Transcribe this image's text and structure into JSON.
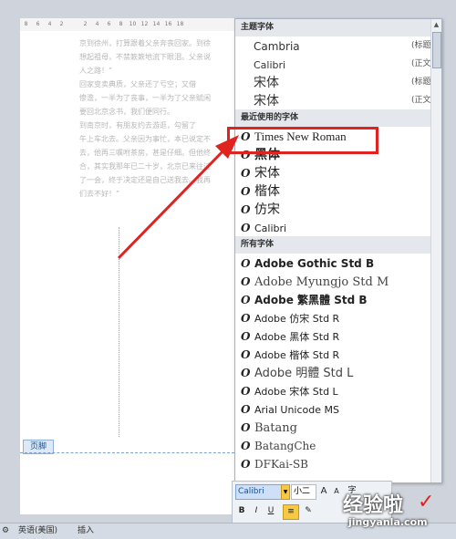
{
  "ruler": {
    "ticks": [
      "8",
      "6",
      "4",
      "2",
      "",
      "2",
      "4",
      "6",
      "8",
      "10",
      "12",
      "14",
      "16",
      "18"
    ]
  },
  "document": {
    "lines": [
      "京到徐州，打算跟着父亲奔丧回家。到徐",
      "想起祖母，不禁簌簌地流下眼泪。父亲说",
      "人之路！”",
      "",
      "回家变卖典质，父亲还了亏空；又借",
      "惨澹，一半为了丧事，一半为了父亲赋闲",
      "要回北京念书，我们便同行。",
      "",
      "到南京时，有朋友约去游逛，勾留了",
      "午上车北去。父亲因为事忙，本已说定不",
      "去，他再三嘱咐茶房，甚是仔细。但他终",
      "合，其实我那年已二十岁，北京已来往过",
      "了一会，终于决定还是自己送我去。我再",
      "们去不好！”"
    ],
    "footer_label": "页脚"
  },
  "font_menu": {
    "theme_header": "主题字体",
    "theme_fonts": [
      {
        "name": "Cambria",
        "tag": "(标题)"
      },
      {
        "name": "Calibri",
        "tag": "(正文)"
      },
      {
        "name": "宋体",
        "tag": "(标题)"
      },
      {
        "name": "宋体",
        "tag": "(正文)"
      }
    ],
    "recent_header": "最近使用的字体",
    "recent_fonts": [
      "Times New Roman",
      "黑体",
      "宋体",
      "楷体",
      "仿宋",
      "Calibri"
    ],
    "all_header": "所有字体",
    "all_fonts": [
      "Adobe Gothic Std B",
      "Adobe Myungjo Std M",
      "Adobe 繁黑體 Std B",
      "Adobe 仿宋 Std R",
      "Adobe 黑体 Std R",
      "Adobe 楷体 Std R",
      "Adobe 明體 Std L",
      "Adobe 宋体 Std L",
      "Arial Unicode MS",
      "Batang",
      "BatangChe",
      "DFKai-SB"
    ],
    "font_icon": "open-type-o-icon",
    "highlight_color": "#e1231f"
  },
  "mini_toolbar": {
    "font_value": "Calibri",
    "size_value": "小二",
    "grow_label": "A",
    "shrink_label": "A",
    "bold_label": "B",
    "italic_label": "I",
    "underline_label": "U",
    "format_label": "字"
  },
  "status_bar": {
    "language": "英语(美国)",
    "mode": "插入"
  },
  "watermark": {
    "brand": "经验啦",
    "check": "✓",
    "url": "jingyanla.com"
  }
}
